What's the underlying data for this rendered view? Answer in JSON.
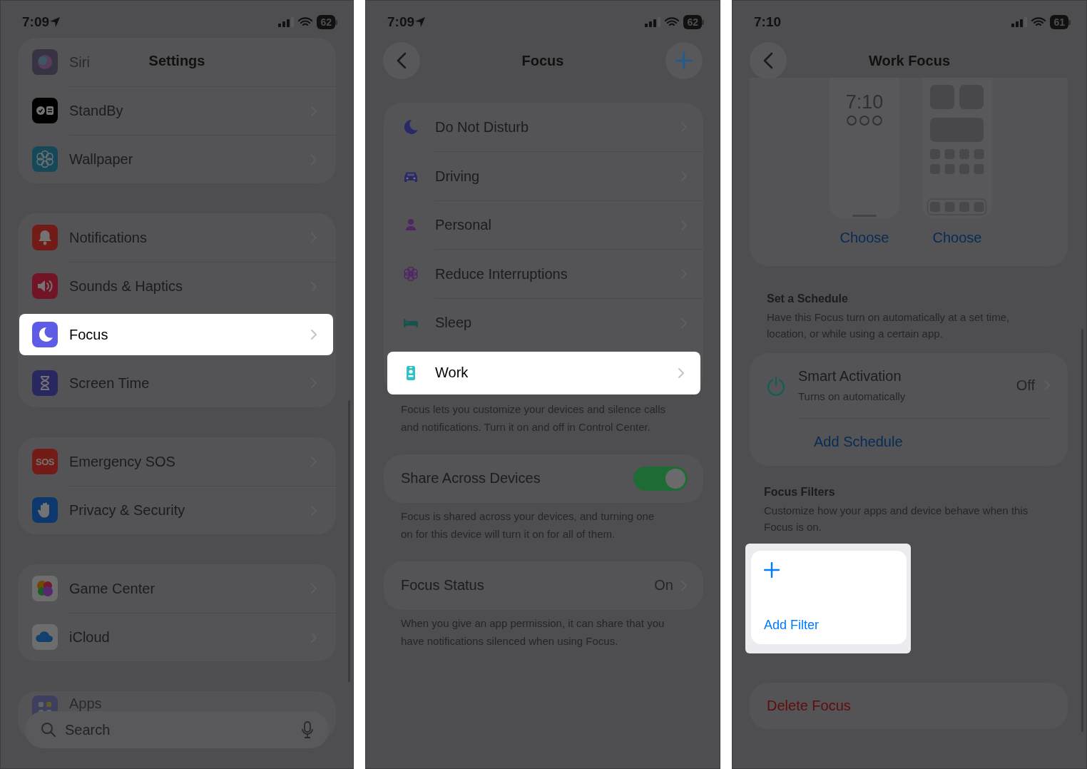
{
  "screens": [
    {
      "kind": "settings",
      "status": {
        "time": "7:09",
        "battery": "62",
        "location": true
      },
      "title": "Settings",
      "groups": [
        {
          "rows": [
            {
              "label": "Siri",
              "kind": "siri",
              "faded": true,
              "highlighted": false
            },
            {
              "label": "StandBy",
              "kind": "standby",
              "faded": false,
              "highlighted": false
            },
            {
              "label": "Wallpaper",
              "kind": "wallpaper",
              "faded": false,
              "highlighted": false
            }
          ]
        },
        {
          "rows": [
            {
              "label": "Notifications",
              "kind": "notifications",
              "faded": false,
              "highlighted": false
            },
            {
              "label": "Sounds & Haptics",
              "kind": "sounds",
              "faded": false,
              "highlighted": false
            },
            {
              "label": "Focus",
              "kind": "focus",
              "faded": false,
              "highlighted": true
            },
            {
              "label": "Screen Time",
              "kind": "screentime",
              "faded": false,
              "highlighted": false
            }
          ]
        },
        {
          "rows": [
            {
              "label": "Emergency SOS",
              "kind": "sos",
              "icon_text": "SOS",
              "faded": false,
              "highlighted": false
            },
            {
              "label": "Privacy & Security",
              "kind": "privacy",
              "faded": false,
              "highlighted": false
            }
          ]
        },
        {
          "rows": [
            {
              "label": "Game Center",
              "kind": "gamecenter",
              "faded": false,
              "highlighted": false
            },
            {
              "label": "iCloud",
              "kind": "icloud",
              "faded": false,
              "highlighted": false
            }
          ]
        },
        {
          "rows": [
            {
              "label": "Apps",
              "kind": "apps",
              "faded": true,
              "highlighted": false
            }
          ]
        }
      ],
      "search": {
        "placeholder": "Search"
      }
    },
    {
      "kind": "focus_list",
      "status": {
        "time": "7:09",
        "battery": "62",
        "location": true
      },
      "title": "Focus",
      "rows": [
        {
          "label": "Do Not Disturb",
          "kind": "moon",
          "highlighted": false
        },
        {
          "label": "Driving",
          "kind": "car",
          "highlighted": false
        },
        {
          "label": "Personal",
          "kind": "person",
          "highlighted": false
        },
        {
          "label": "Reduce Interruptions",
          "kind": "flower",
          "highlighted": false
        },
        {
          "label": "Sleep",
          "kind": "bed",
          "highlighted": false
        },
        {
          "label": "Work",
          "kind": "badge",
          "highlighted": true
        }
      ],
      "rows_footer": "Focus lets you customize your devices and silence calls and notifications. Turn it on and off in Control Center.",
      "share": {
        "label": "Share Across Devices",
        "on": true,
        "footer": "Focus is shared across your devices, and turning one on for this device will turn it on for all of them."
      },
      "status_row": {
        "label": "Focus Status",
        "value": "On",
        "footer": "When you give an app permission, it can share that you have notifications silenced when using Focus."
      }
    },
    {
      "kind": "focus_detail",
      "status": {
        "time": "7:10",
        "battery": "61",
        "location": false
      },
      "title": "Work Focus",
      "previews": [
        {
          "kind": "lock",
          "clock": "7:10",
          "action": "Choose"
        },
        {
          "kind": "home",
          "action": "Choose"
        }
      ],
      "schedule": {
        "heading": "Set a Schedule",
        "description": "Have this Focus turn on automatically at a set time, location, or while using a certain app.",
        "smart": {
          "title": "Smart Activation",
          "subtitle": "Turns on automatically",
          "value": "Off"
        },
        "add": "Add Schedule"
      },
      "filters": {
        "heading": "Focus Filters",
        "description": "Customize how your apps and device behave when this Focus is on.",
        "add": {
          "label": "Add Filter",
          "highlighted": true
        }
      },
      "delete": "Delete Focus"
    }
  ]
}
